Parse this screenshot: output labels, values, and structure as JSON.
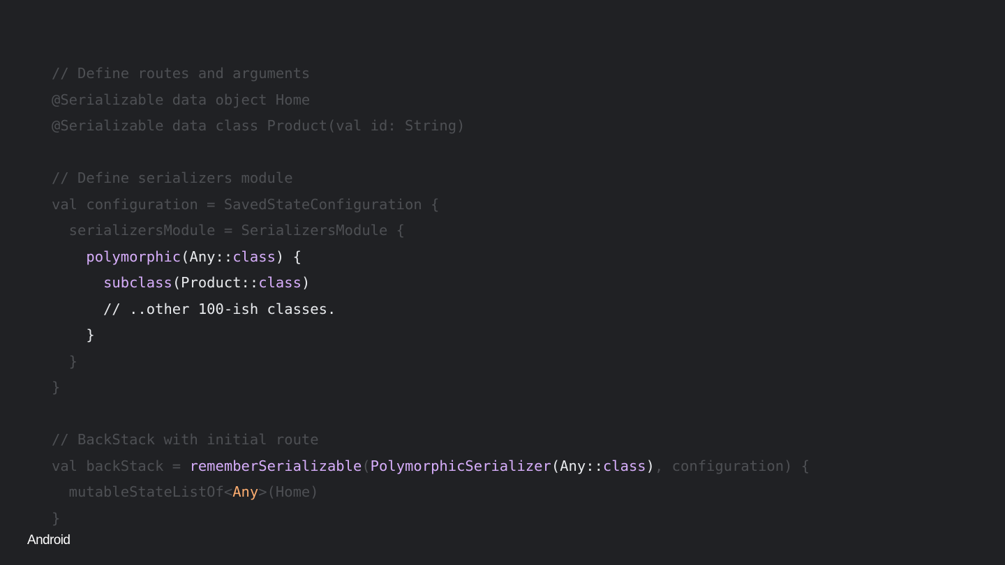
{
  "colors": {
    "background": "#202124",
    "dimmed_text": "#4e5054",
    "highlight_text": "#e8eaed",
    "function_purple": "#d7aefb",
    "type_orange": "#fcad70",
    "brand": "#ffffff"
  },
  "brand": {
    "label": "Android"
  },
  "code_lines": [
    {
      "tokens": [
        {
          "text": "// Define routes and arguments",
          "style": "dim"
        }
      ]
    },
    {
      "tokens": [
        {
          "text": "@Serializable data object Home",
          "style": "dim"
        }
      ]
    },
    {
      "tokens": [
        {
          "text": "@Serializable data class Product(val id: String)",
          "style": "dim"
        }
      ]
    },
    {
      "tokens": [
        {
          "text": "",
          "style": "dim"
        }
      ]
    },
    {
      "tokens": [
        {
          "text": "// Define serializers module",
          "style": "dim"
        }
      ]
    },
    {
      "tokens": [
        {
          "text": "val configuration = SavedStateConfiguration {",
          "style": "dim"
        }
      ]
    },
    {
      "tokens": [
        {
          "text": "  serializersModule = SerializersModule {",
          "style": "dim"
        }
      ]
    },
    {
      "tokens": [
        {
          "text": "    ",
          "style": "hl"
        },
        {
          "text": "polymorphic",
          "style": "fn"
        },
        {
          "text": "(Any::",
          "style": "hl"
        },
        {
          "text": "class",
          "style": "kw"
        },
        {
          "text": ") {",
          "style": "hl"
        }
      ]
    },
    {
      "tokens": [
        {
          "text": "      ",
          "style": "hl"
        },
        {
          "text": "subclass",
          "style": "fn"
        },
        {
          "text": "(Product::",
          "style": "hl"
        },
        {
          "text": "class",
          "style": "kw"
        },
        {
          "text": ")",
          "style": "hl"
        }
      ]
    },
    {
      "tokens": [
        {
          "text": "      // ..other 100-ish classes.",
          "style": "hl"
        }
      ]
    },
    {
      "tokens": [
        {
          "text": "    }",
          "style": "hl"
        }
      ]
    },
    {
      "tokens": [
        {
          "text": "  }",
          "style": "dim"
        }
      ]
    },
    {
      "tokens": [
        {
          "text": "}",
          "style": "dim"
        }
      ]
    },
    {
      "tokens": [
        {
          "text": "",
          "style": "dim"
        }
      ]
    },
    {
      "tokens": [
        {
          "text": "// BackStack with initial route",
          "style": "dim"
        }
      ]
    },
    {
      "tokens": [
        {
          "text": "val backStack = ",
          "style": "dim"
        },
        {
          "text": "rememberSerializable",
          "style": "fn"
        },
        {
          "text": "(",
          "style": "dim"
        },
        {
          "text": "PolymorphicSerializer",
          "style": "fn"
        },
        {
          "text": "(Any::",
          "style": "hl"
        },
        {
          "text": "class",
          "style": "kw"
        },
        {
          "text": ")",
          "style": "hl"
        },
        {
          "text": ", configuration) {",
          "style": "dim"
        }
      ]
    },
    {
      "tokens": [
        {
          "text": "  mutableStateListOf<",
          "style": "dim"
        },
        {
          "text": "Any",
          "style": "typ"
        },
        {
          "text": ">(Home)",
          "style": "dim"
        }
      ]
    },
    {
      "tokens": [
        {
          "text": "}",
          "style": "dim"
        }
      ]
    }
  ]
}
